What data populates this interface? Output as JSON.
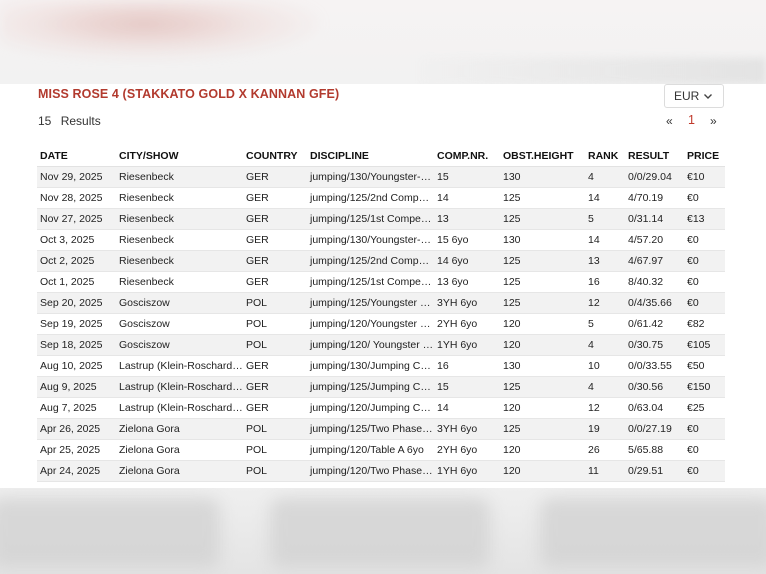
{
  "header": {
    "title": "MISS ROSE 4 (STAKKATO GOLD X KANNAN GFE)",
    "currency": "EUR",
    "results_count": "15",
    "results_label": "Results"
  },
  "pagination": {
    "prev": "«",
    "current": "1",
    "next": "»"
  },
  "table": {
    "columns": [
      "DATE",
      "CITY/SHOW",
      "COUNTRY",
      "DISCIPLINE",
      "COMP.NR.",
      "OBST.HEIGHT",
      "RANK",
      "RESULT",
      "PRICE"
    ],
    "rows": [
      [
        "Nov 29, 2025",
        "Riesenbeck",
        "GER",
        "jumping/130/Youngster-…",
        "15",
        "130",
        "4",
        "0/0/29.04",
        "€10"
      ],
      [
        "Nov 28, 2025",
        "Riesenbeck",
        "GER",
        "jumping/125/2nd Compe…",
        "14",
        "125",
        "14",
        "4/70.19",
        "€0"
      ],
      [
        "Nov 27, 2025",
        "Riesenbeck",
        "GER",
        "jumping/125/1st Compet…",
        "13",
        "125",
        "5",
        "0/31.14",
        "€13"
      ],
      [
        "Oct 3, 2025",
        "Riesenbeck",
        "GER",
        "jumping/130/Youngster-…",
        "15 6yo",
        "130",
        "14",
        "4/57.20",
        "€0"
      ],
      [
        "Oct 2, 2025",
        "Riesenbeck",
        "GER",
        "jumping/125/2nd Compe…",
        "14 6yo",
        "125",
        "13",
        "4/67.97",
        "€0"
      ],
      [
        "Oct 1, 2025",
        "Riesenbeck",
        "GER",
        "jumping/125/1st Compet…",
        "13 6yo",
        "125",
        "16",
        "8/40.32",
        "€0"
      ],
      [
        "Sep 20, 2025",
        "Gosciszow",
        "POL",
        "jumping/125/Youngster …",
        "3YH 6yo",
        "125",
        "12",
        "0/4/35.66",
        "€0"
      ],
      [
        "Sep 19, 2025",
        "Gosciszow",
        "POL",
        "jumping/120/Youngster …",
        "2YH 6yo",
        "120",
        "5",
        "0/61.42",
        "€82"
      ],
      [
        "Sep 18, 2025",
        "Gosciszow",
        "POL",
        "jumping/120/ Youngster …",
        "1YH 6yo",
        "120",
        "4",
        "0/30.75",
        "€105"
      ],
      [
        "Aug 10, 2025",
        "Lastrup (Klein-Roscharde…",
        "GER",
        "jumping/130/Jumping Co…",
        "16",
        "130",
        "10",
        "0/0/33.55",
        "€50"
      ],
      [
        "Aug 9, 2025",
        "Lastrup (Klein-Roscharde…",
        "GER",
        "jumping/125/Jumping Co…",
        "15",
        "125",
        "4",
        "0/30.56",
        "€150"
      ],
      [
        "Aug 7, 2025",
        "Lastrup (Klein-Roscharde…",
        "GER",
        "jumping/120/Jumping Co…",
        "14",
        "120",
        "12",
        "0/63.04",
        "€25"
      ],
      [
        "Apr 26, 2025",
        "Zielona Gora",
        "POL",
        "jumping/125/Two Phase…",
        "3YH 6yo",
        "125",
        "19",
        "0/0/27.19",
        "€0"
      ],
      [
        "Apr 25, 2025",
        "Zielona Gora",
        "POL",
        "jumping/120/Table A 6yo",
        "2YH 6yo",
        "120",
        "26",
        "5/65.88",
        "€0"
      ],
      [
        "Apr 24, 2025",
        "Zielona Gora",
        "POL",
        "jumping/120/Two Phase…",
        "1YH 6yo",
        "120",
        "11",
        "0/29.51",
        "€0"
      ]
    ]
  },
  "icons": {
    "currency_dropdown": "chevron-down-icon"
  },
  "colors": {
    "title": "#b23a2e",
    "current_page": "#c0392b",
    "row_stripe": "#f2f2f2"
  }
}
